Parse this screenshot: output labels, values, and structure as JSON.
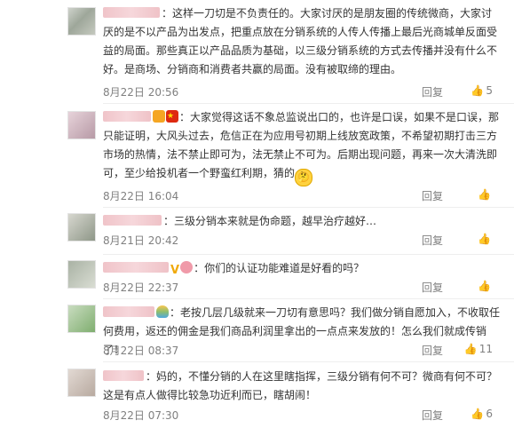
{
  "comments": [
    {
      "text": "：这样一刀切是不负责任的。大家讨厌的是朋友圈的传统微商，大家讨厌的是不以产品为出发点，把重点放在分销系统的人传人传播上最后光商城单反面受益的局面。那些真正以产品品质为基础，以三级分销系统的方式去传播并没有什么不好。是商场、分销商和消费者共赢的局面。没有被取缔的理由。",
      "time": "8月22日 20:56",
      "reply": "回复",
      "likes": "5"
    },
    {
      "text": "：大家觉得这话不象总监说出口的，也许是口误，如果不是口误，那只能证明，大风头过去，危信正在为应用号初期上线放宽政策，不希望初期打击三方市场的热情，法不禁止即可为，法无禁止不可为。后期出现问题，再来一次大清洗即可，至少给投机者一个野蛮红利期，猜的",
      "time": "8月22日 16:04",
      "reply": "回复",
      "likes": ""
    },
    {
      "text": "：三级分销本来就是伪命题，越早治疗越好…",
      "time": "8月21日 20:42",
      "reply": "回复",
      "likes": ""
    },
    {
      "text": "：你们的认证功能难道是好看的吗？",
      "time": "8月22日 22:37",
      "reply": "回复",
      "likes": ""
    },
    {
      "text": "：老按几层几级就来一刀切有意思吗？我们做分销自愿加入，不收取任何费用，返还的佣金是我们商品利润里拿出的一点点来发放的！怎么我们就成传销了！",
      "time": "8月22日 08:37",
      "reply": "回复",
      "likes": "11"
    },
    {
      "text": "：妈的，不懂分销的人在这里瞎指挥，三级分销有何不可？微商有何不可？这是有点人做得比较急功近利而已，瞎胡闹！",
      "time": "8月22日 07:30",
      "reply": "回复",
      "likes": "6"
    }
  ]
}
